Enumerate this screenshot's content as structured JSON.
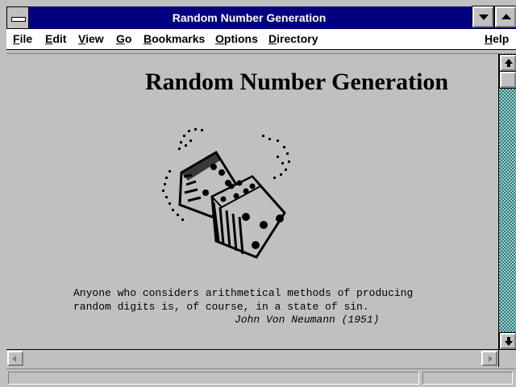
{
  "window": {
    "title": "Random Number Generation"
  },
  "menu": {
    "items": [
      {
        "underline": "F",
        "rest": "ile"
      },
      {
        "underline": "E",
        "rest": "dit"
      },
      {
        "underline": "V",
        "rest": "iew"
      },
      {
        "underline": "G",
        "rest": "o"
      },
      {
        "underline": "B",
        "rest": "ookmarks"
      },
      {
        "underline": "O",
        "rest": "ptions"
      },
      {
        "underline": "D",
        "rest": "irectory"
      },
      {
        "underline": "H",
        "rest": "elp"
      }
    ]
  },
  "document": {
    "heading": "Random Number Generation",
    "image_icon": "dice-image",
    "quote_line1": "Anyone who considers arithmetical methods of producing",
    "quote_line2": "random digits is, of course, in a state of sin.",
    "attribution": "John Von Neumann (1951)"
  },
  "status": {
    "text": ""
  },
  "colors": {
    "titlebar": "#000080",
    "chrome": "#c0c0c0",
    "desktop": "#008080"
  }
}
